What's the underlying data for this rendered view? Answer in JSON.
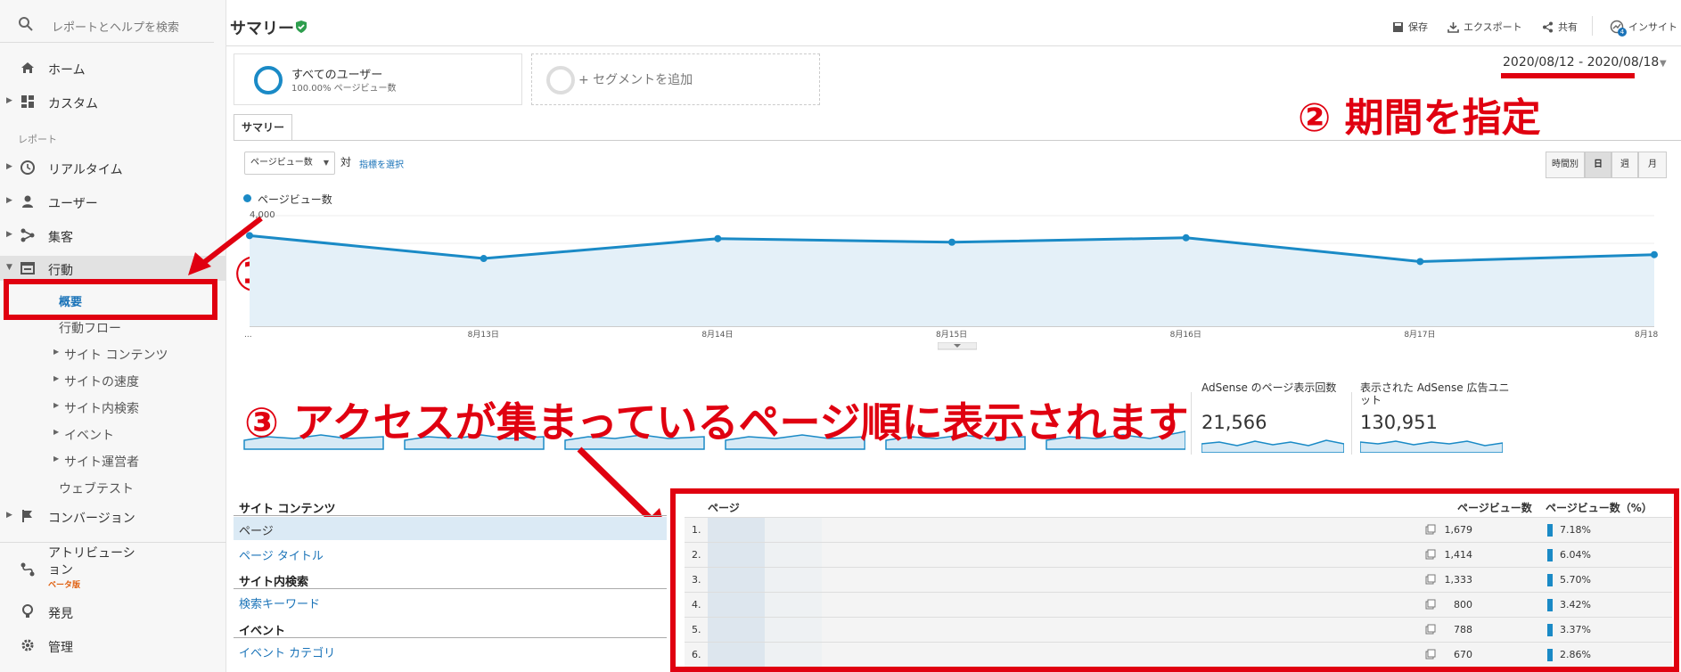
{
  "sidebar": {
    "search_placeholder": "レポートとヘルプを検索",
    "home": "ホーム",
    "custom": "カスタム",
    "reports_label": "レポート",
    "realtime": "リアルタイム",
    "users": "ユーザー",
    "acquisition": "集客",
    "behavior": "行動",
    "behavior_items": [
      "概要",
      "行動フロー",
      "サイト コンテンツ",
      "サイトの速度",
      "サイト内検索",
      "イベント",
      "サイト運営者",
      "ウェブテスト"
    ],
    "conversion": "コンバージョン",
    "attribution": "アトリビューション",
    "attribution_badge": "ベータ版",
    "discover": "発見",
    "admin": "管理"
  },
  "header": {
    "title": "サマリー",
    "save": "保存",
    "export": "エクスポート",
    "share": "共有",
    "insights": "インサイト",
    "insights_count": "4"
  },
  "segments": {
    "all_users": "すべてのユーザー",
    "all_users_sub": "100.00% ページビュー数",
    "add_segment": "+ セグメントを追加"
  },
  "date_range": "2020/08/12 - 2020/08/18",
  "annotations": {
    "one": "①",
    "two": "② 期間を指定",
    "three": "③ アクセスが集まっているページ順に表示されます"
  },
  "tab": "サマリー",
  "controls": {
    "metric": "ページビュー数",
    "vs": "対",
    "pick_metric": "指標を選択",
    "granularity": [
      "時間別",
      "日",
      "週",
      "月"
    ],
    "granularity_selected": "日"
  },
  "chart_data": {
    "type": "area",
    "series": [
      {
        "name": "ページビュー数",
        "color": "#1a8ac6"
      }
    ],
    "x_labels": [
      "...",
      "8月13日",
      "8月14日",
      "8月15日",
      "8月16日",
      "8月17日",
      "8月18日"
    ],
    "y_tick_label": "4,000",
    "values": [
      3280,
      2450,
      3170,
      3040,
      3200,
      2340,
      2590
    ],
    "ylim": [
      0,
      4000
    ]
  },
  "scorecards": [
    {
      "title": "AdSense のページ表示回数",
      "value": "21,566"
    },
    {
      "title": "表示された AdSense 広告ユニット",
      "value": "130,951"
    }
  ],
  "left_table": {
    "site_content": "サイト コンテンツ",
    "page": "ページ",
    "page_title": "ページ タイトル",
    "site_search": "サイト内検索",
    "search_keyword": "検索キーワード",
    "events": "イベント",
    "event_category": "イベント カテゴリ"
  },
  "page_table": {
    "col_page": "ページ",
    "col_pv": "ページビュー数",
    "col_pct": "ページビュー数（%）",
    "rows": [
      {
        "num": "1.",
        "pv": "1,679",
        "pct": "7.18%"
      },
      {
        "num": "2.",
        "pv": "1,414",
        "pct": "6.04%"
      },
      {
        "num": "3.",
        "pv": "1,333",
        "pct": "5.70%"
      },
      {
        "num": "4.",
        "pv": "800",
        "pct": "3.42%"
      },
      {
        "num": "5.",
        "pv": "788",
        "pct": "3.37%"
      },
      {
        "num": "6.",
        "pv": "670",
        "pct": "2.86%"
      }
    ]
  }
}
